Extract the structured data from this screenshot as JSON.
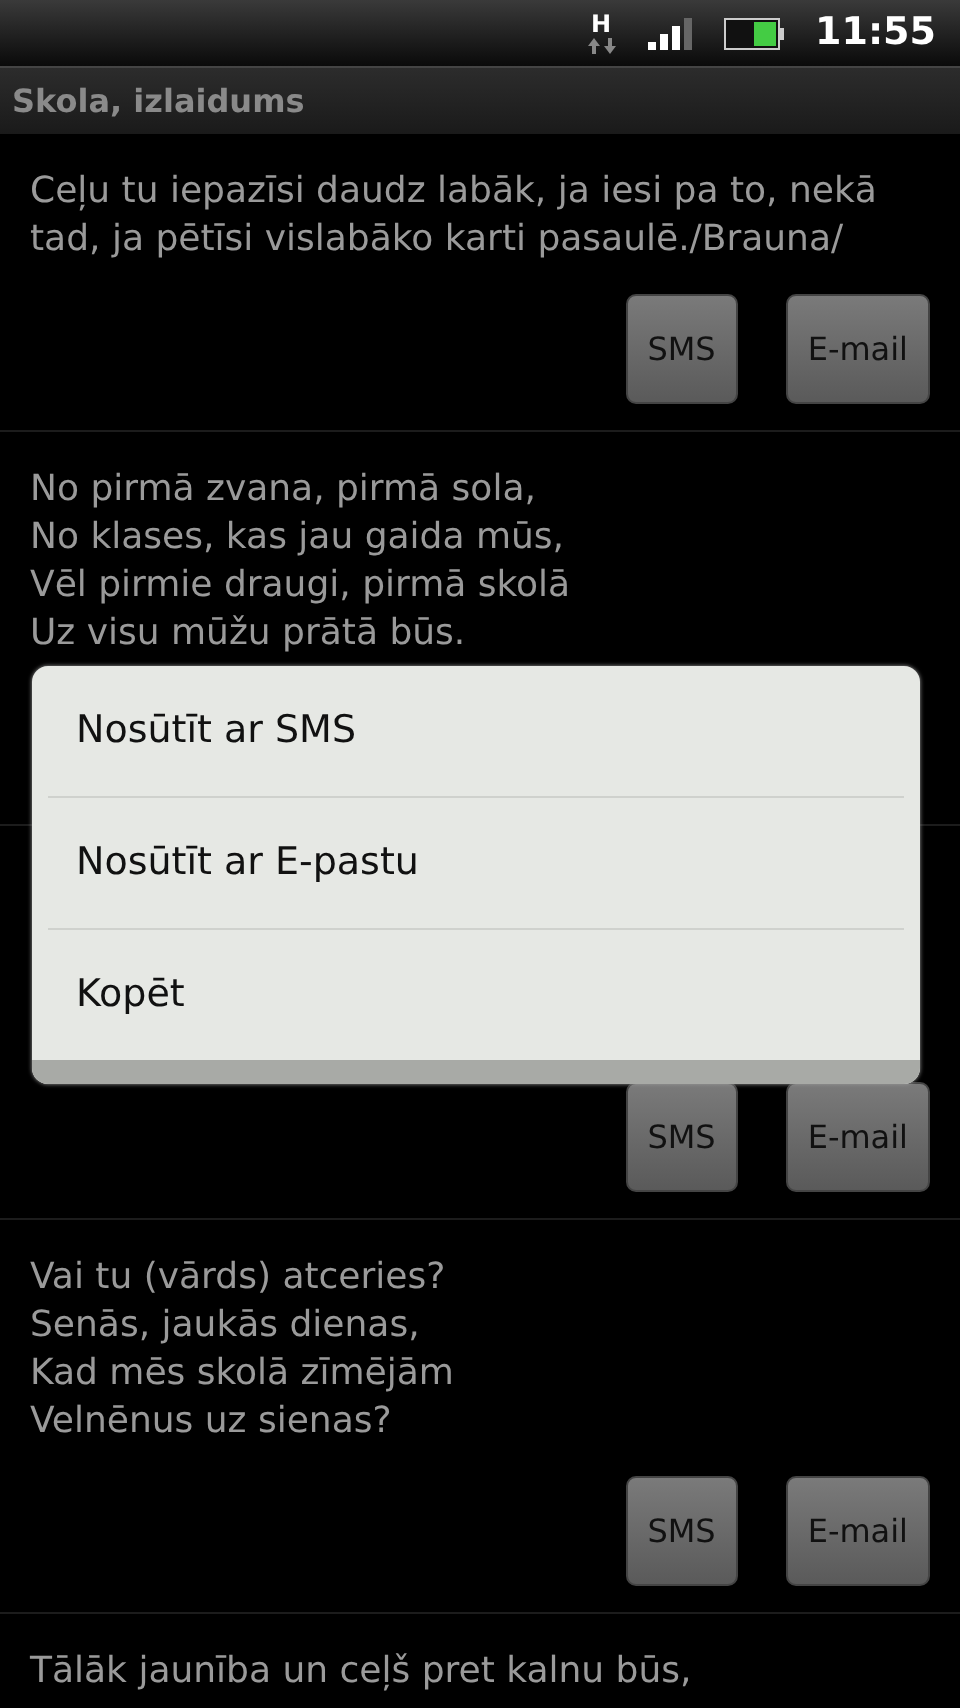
{
  "status_bar": {
    "network": "H",
    "time": "11:55"
  },
  "title": "Skola, izlaidums",
  "entries": [
    {
      "text": "Ceļu tu iepazīsi daudz labāk, ja iesi pa to, nekā tad, ja pētīsi vislabāko karti pasaulē./Brauna/",
      "buttons": [
        "SMS",
        "E-mail"
      ]
    },
    {
      "text": "No pirmā zvana, pirmā sola,\nNo klases, kas jau gaida mūs,\nVēl pirmie draugi, pirmā skolā\nUz visu mūžu prātā būs."
    },
    {
      "buttons": [
        "SMS",
        "E-mail"
      ]
    },
    {
      "text": "Vai tu (vārds) atceries?\nSenās, jaukās dienas,\nKad mēs skolā zīmējām\nVelnēnus uz sienas?",
      "buttons": [
        "SMS",
        "E-mail"
      ]
    },
    {
      "text": "Tālāk jaunība un ceļš pret kalnu būs,"
    }
  ],
  "context_menu": {
    "items": [
      "Nosūtīt ar SMS",
      "Nosūtīt ar E-pastu",
      "Kopēt"
    ]
  }
}
